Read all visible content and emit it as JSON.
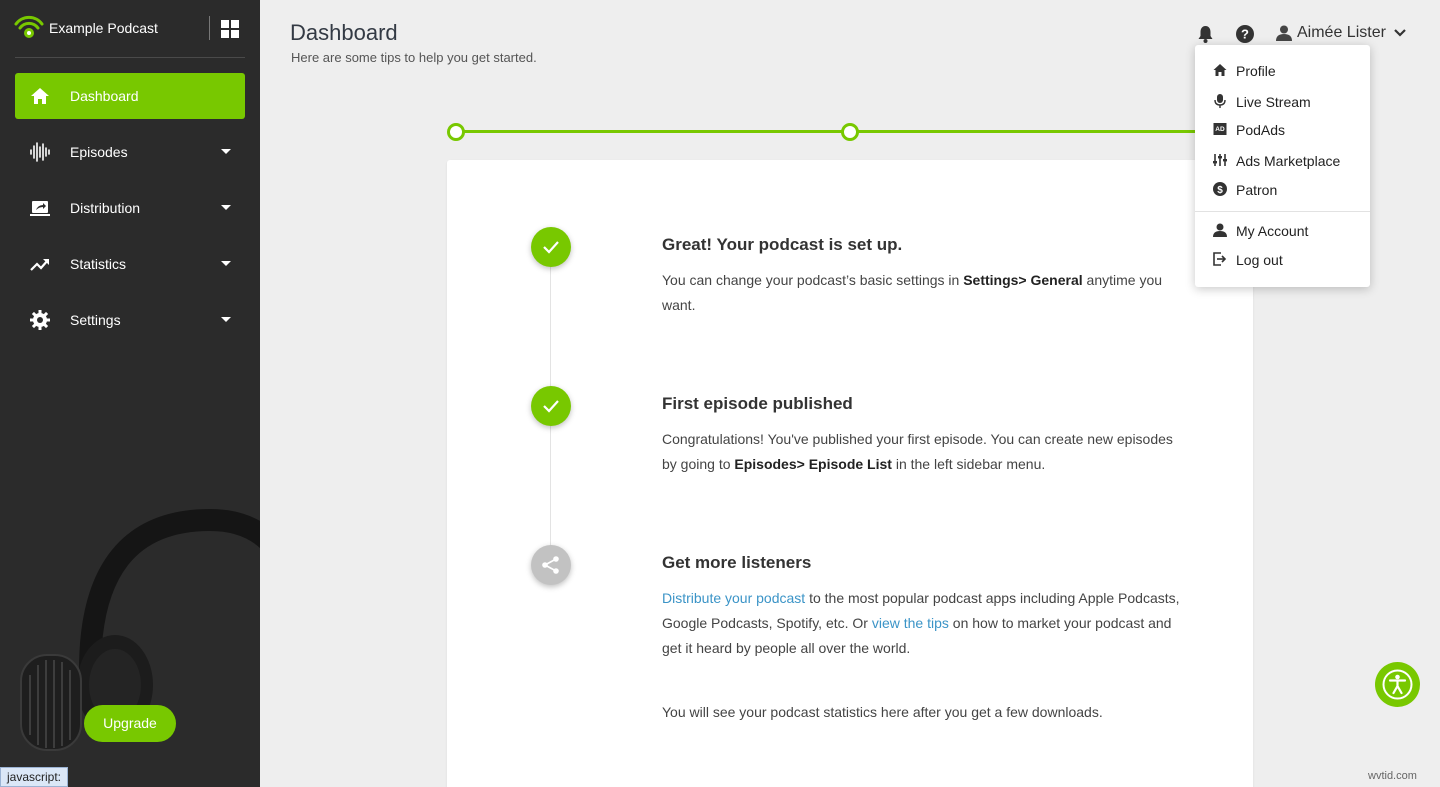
{
  "app": {
    "name": "Example Podcast"
  },
  "sidebar": {
    "items": [
      {
        "label": "Dashboard",
        "icon": "home-icon",
        "active": true
      },
      {
        "label": "Episodes",
        "icon": "waveform-icon"
      },
      {
        "label": "Distribution",
        "icon": "distribution-icon"
      },
      {
        "label": "Statistics",
        "icon": "trending-up-icon"
      },
      {
        "label": "Settings",
        "icon": "gear-icon"
      }
    ],
    "upgrade_label": "Upgrade"
  },
  "status_bar": {
    "text": "javascript:"
  },
  "header": {
    "title": "Dashboard",
    "subtitle": "Here are some tips to help you get started.",
    "user_name": "Aimée Lister"
  },
  "user_dropdown": {
    "items": [
      {
        "label": "Profile",
        "icon": "home-icon"
      },
      {
        "label": "Live Stream",
        "icon": "microphone-icon"
      },
      {
        "label": "PodAds",
        "icon": "ad-icon"
      },
      {
        "label": "Ads Marketplace",
        "icon": "sliders-icon"
      },
      {
        "label": "Patron",
        "icon": "dollar-icon"
      },
      {
        "label": "My Account",
        "icon": "user-icon"
      },
      {
        "label": "Log out",
        "icon": "logout-icon"
      }
    ]
  },
  "steps": [
    {
      "title": "Great! Your podcast is set up.",
      "body_pre": "You can change your podcast’s basic settings in ",
      "body_bold": "Settings> General",
      "body_post": " anytime you want.",
      "status": "done"
    },
    {
      "title": "First episode published",
      "body_pre": "Congratulations! You've published your first episode. You can create new episodes by going to ",
      "body_bold": "Episodes> Episode List",
      "body_post": " in the left sidebar menu.",
      "status": "done"
    },
    {
      "title": "Get more listeners",
      "link1": "Distribute your podcast",
      "body_mid": " to the most popular podcast apps including Apple Podcasts, Google Podcasts, Spotify, etc. Or ",
      "link2": "view the tips",
      "body_post": " on how to market your podcast and get it heard by people all over the world.",
      "status": "pending"
    }
  ],
  "stats_note": "You will see your podcast statistics here after you get a few downloads.",
  "watermark": "wvtid.com",
  "colors": {
    "accent": "#78c800",
    "sidebar_bg": "#2b2b2b",
    "link": "#3b94c7",
    "page_bg": "#eeeeee"
  }
}
